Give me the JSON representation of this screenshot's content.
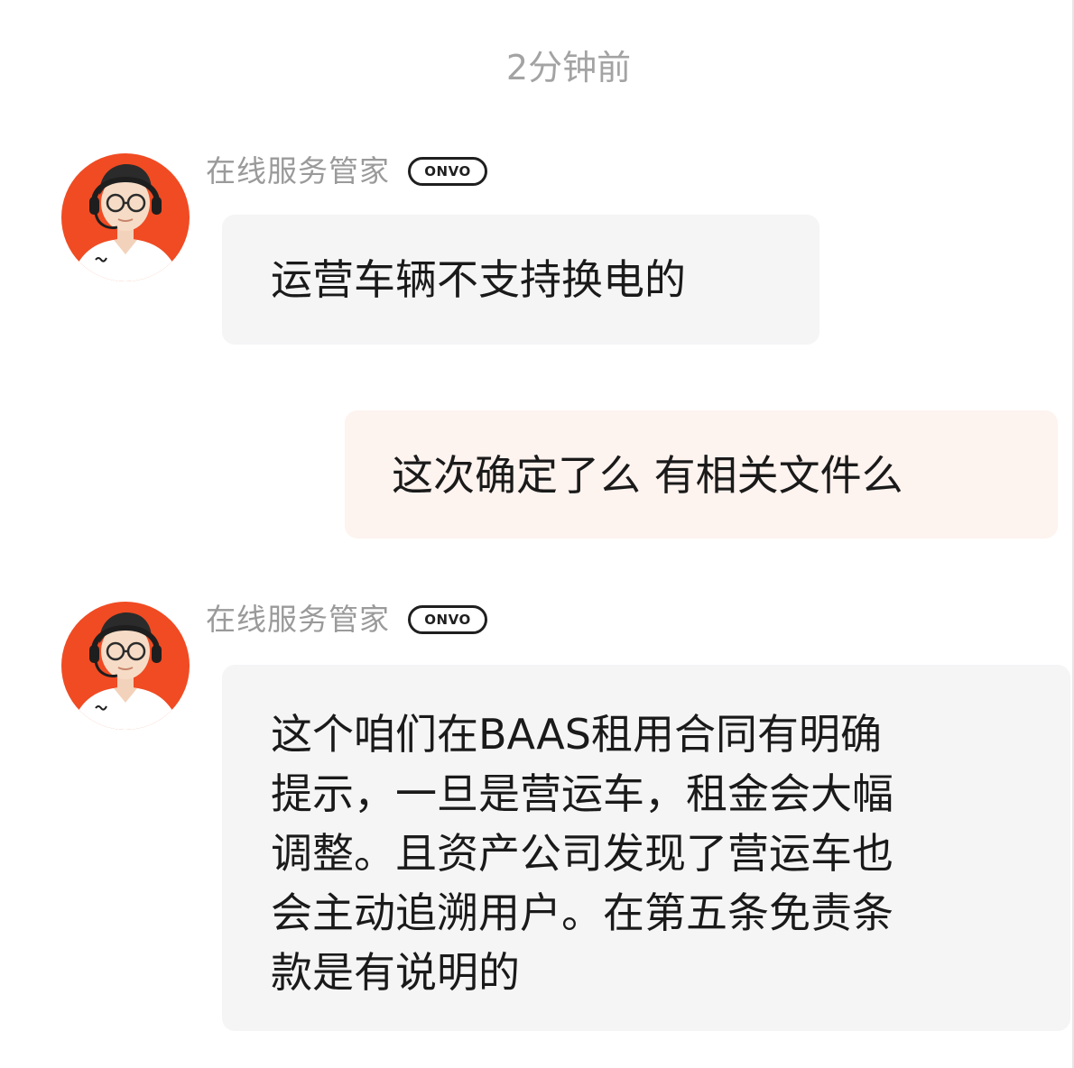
{
  "timestamp": "2分钟前",
  "colors": {
    "avatar_bg": "#f04b23",
    "agent_bubble": "#f5f5f6",
    "user_bubble": "#fdf3ef",
    "sender_name": "#9a9a9a",
    "timestamp": "#a3a3a3"
  },
  "messages": [
    {
      "role": "agent",
      "sender": "在线服务管家",
      "badge": "ONVO",
      "avatar_icon": "headset-agent-avatar-icon",
      "lines": [
        "运营车辆不支持换电的"
      ]
    },
    {
      "role": "user",
      "lines": [
        "这次确定了么 有相关文件么"
      ]
    },
    {
      "role": "agent",
      "sender": "在线服务管家",
      "badge": "ONVO",
      "avatar_icon": "headset-agent-avatar-icon",
      "lines": [
        "这个咱们在BAAS租用合同有明确",
        "提示，一旦是营运车，租金会大幅",
        "调整。且资产公司发现了营运车也",
        "会主动追溯用户。在第五条免责条",
        "款是有说明的"
      ]
    }
  ]
}
